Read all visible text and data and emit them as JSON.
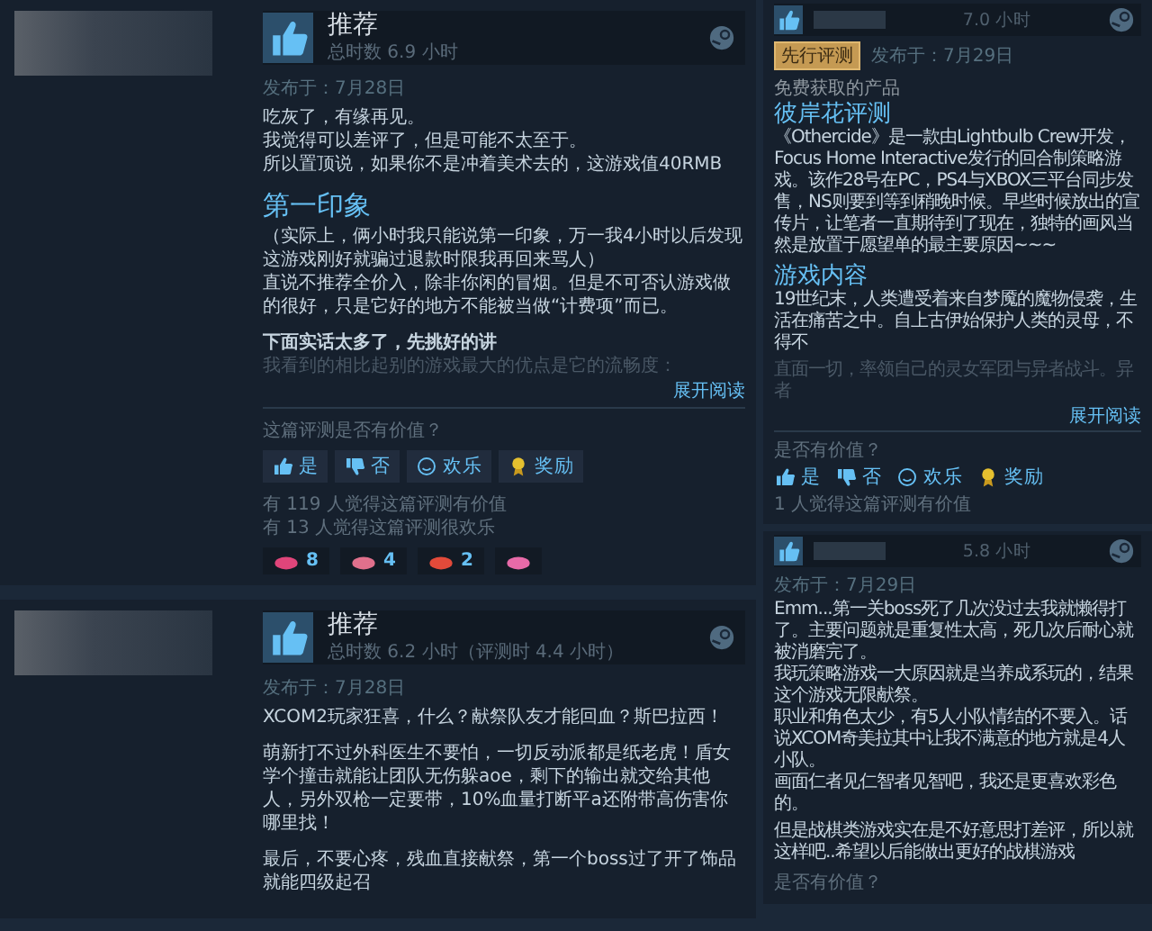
{
  "left_reviews": [
    {
      "recommendation": "推荐",
      "hours": "总时数 6.9 小时",
      "posted": "发布于：7月28日",
      "blocks": [
        {
          "kind": "paragraph",
          "lines": [
            "吃灰了，有缘再见。",
            "我觉得可以差评了，但是可能不太至于。",
            "所以置顶说，如果你不是冲着美术去的，这游戏值40RMB"
          ]
        },
        {
          "kind": "heading",
          "text": "第一印象"
        },
        {
          "kind": "paragraph",
          "lines": [
            "（实际上，俩小时我只能说第一印象，万一我4小时以后发现这游戏刚好就骗过退款时限我再回来骂人）",
            "直说不推荐全价入，除非你闲的冒烟。但是不可否认游戏做的很好，只是它好的地方不能被当做“计费项”而已。"
          ]
        },
        {
          "kind": "bold",
          "text": "下面实话太多了，先挑好的讲"
        },
        {
          "kind": "faded",
          "text": "我看到的相比起别的游戏最大的优点是它的流畅度："
        }
      ],
      "read_more": "展开阅读",
      "question": "这篇评测是否有价值？",
      "votes": [
        {
          "kind": "yes",
          "label": "是"
        },
        {
          "kind": "no",
          "label": "否"
        },
        {
          "kind": "funny",
          "label": "欢乐"
        },
        {
          "kind": "award",
          "label": "奖励"
        }
      ],
      "counts": [
        "有 119 人觉得这篇评测有价值",
        "有 13 人觉得这篇评测很欢乐"
      ],
      "awards": [
        {
          "color": "#e0457a",
          "count": "8"
        },
        {
          "color": "#e0708c",
          "count": "4"
        },
        {
          "color": "#e24a3a",
          "count": "2"
        },
        {
          "color": "#e76aa8"
        }
      ]
    },
    {
      "recommendation": "推荐",
      "hours": "总时数 6.2 小时（评测时 4.4 小时）",
      "posted": "发布于：7月28日",
      "blocks": [
        {
          "kind": "paragraph",
          "lines": [
            "XCOM2玩家狂喜，什么？献祭队友才能回血？斯巴拉西！"
          ]
        },
        {
          "kind": "paragraph",
          "lines": [
            "萌新打不过外科医生不要怕，一切反动派都是纸老虎！盾女学个撞击就能让团队无伤躲aoe，剩下的输出就交给其他人，另外双枪一定要带，10%血量打断平a还附带高伤害你哪里找！"
          ]
        },
        {
          "kind": "paragraph",
          "lines": [
            "最后，不要心疼，残血直接献祭，第一个boss过了开了饰品就能四级起召"
          ]
        }
      ]
    }
  ],
  "right_reviews": [
    {
      "hours": "7.0 小时",
      "badge": "先行评测",
      "posted": "发布于：7月29日",
      "note": "免费获取的产品",
      "blocks": [
        {
          "kind": "heading",
          "text": "彼岸花评测"
        },
        {
          "kind": "paragraph",
          "lines": [
            "《Othercide》是一款由Lightbulb Crew开发，Focus Home Interactive发行的回合制策略游戏。该作28号在PC，PS4与XBOX三平台同步发售，NS则要到等到稍晚时候。早些时候放出的宣传片，让笔者一直期待到了现在，独特的画风当然是放置于愿望单的最主要原因~~~"
          ]
        },
        {
          "kind": "heading",
          "text": "游戏内容"
        },
        {
          "kind": "paragraph",
          "lines": [
            "19世纪末，人类遭受着来自梦魇的魔物侵袭，生活在痛苦之中。自上古伊始保护人类的灵母，不得不"
          ]
        },
        {
          "kind": "faded",
          "text": "直面一切，率领自己的灵女军团与异者战斗。异者"
        }
      ],
      "read_more": "展开阅读",
      "question": "是否有价值？",
      "votes": [
        {
          "kind": "yes",
          "label": "是"
        },
        {
          "kind": "no",
          "label": "否"
        },
        {
          "kind": "funny",
          "label": "欢乐"
        },
        {
          "kind": "award",
          "label": "奖励"
        }
      ],
      "counts": [
        "1 人觉得这篇评测有价值"
      ]
    },
    {
      "hours": "5.8 小时",
      "posted": "发布于：7月29日",
      "blocks": [
        {
          "kind": "paragraph",
          "lines": [
            "Emm...第一关boss死了几次没过去我就懒得打了。主要问题就是重复性太高，死几次后耐心就被消磨完了。",
            "我玩策略游戏一大原因就是当养成系玩的，结果这个游戏无限献祭。",
            "职业和角色太少，有5人小队情结的不要入。话说XCOM奇美拉其中让我不满意的地方就是4人小队。",
            "画面仁者见仁智者见智吧，我还是更喜欢彩色的。"
          ]
        },
        {
          "kind": "paragraph",
          "lines": [
            "但是战棋类游戏实在是不好意思打差评，所以就这样吧..希望以后能做出更好的战棋游戏"
          ]
        }
      ],
      "question": "是否有价值？"
    }
  ]
}
